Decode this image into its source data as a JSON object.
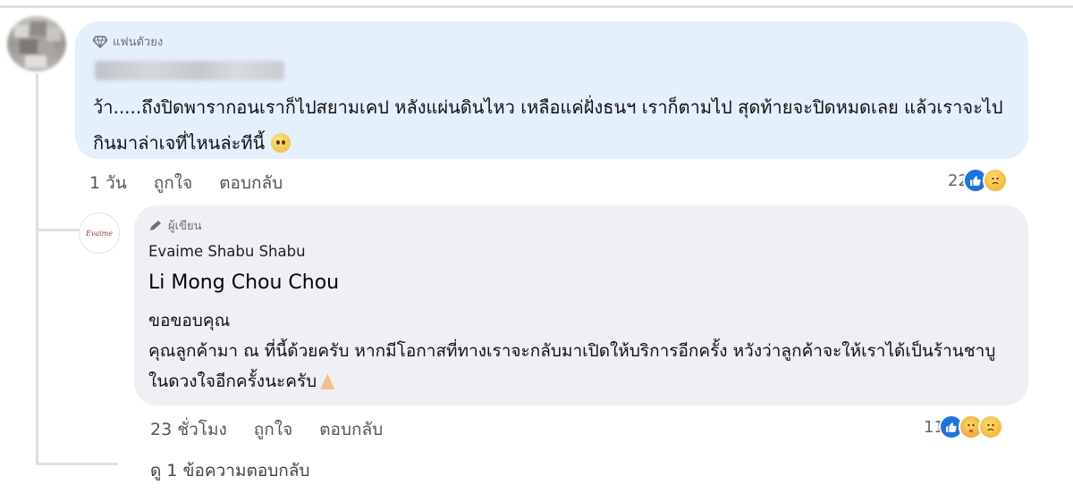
{
  "comment": {
    "badge_label": "แฟนตัวยง",
    "text": "ว้า.....ถึงปิดพารากอนเราก็ไปสยามเคป หลังแผ่นดินไหว เหลือแค่ฝั่งธนฯ เราก็ตามไป สุดท้ายจะปิดหมดเลย แล้วเราจะไปกินมาล่าเจที่ไหนล่ะทีนี้",
    "emoji": "pleading-face",
    "time": "1 วัน",
    "like_label": "ถูกใจ",
    "reply_label": "ตอบกลับ",
    "reaction_count": "22",
    "reactions": [
      "like-icon",
      "sad-icon"
    ]
  },
  "reply": {
    "avatar_text": "Evaime",
    "badge_label": "ผู้เขียน",
    "author": "Evaime Shabu Shabu",
    "mention": "Li Mong Chou Chou",
    "line1": "ขอขอบคุณ",
    "text": "คุณลูกค้ามา ณ ที่นี้ด้วยครับ หากมีโอกาสที่ทางเราจะกลับมาเปิดให้บริการอีกครั้ง หวังว่าลูกค้าจะให้เราได้เป็นร้านชาบูในดวงใจอีกครั้งนะครับ",
    "emoji": "folded-hands",
    "time": "23 ชั่วโมง",
    "like_label": "ถูกใจ",
    "reply_label": "ตอบกลับ",
    "reaction_count": "11",
    "reactions": [
      "like-icon",
      "care-icon",
      "sad-icon"
    ]
  },
  "view_replies": "ดู 1 ข้อความตอบกลับ",
  "colors": {
    "bubble_fan": "#e5f0fd",
    "bubble_author": "#eef0f3",
    "like_blue": "#1b74e4"
  }
}
